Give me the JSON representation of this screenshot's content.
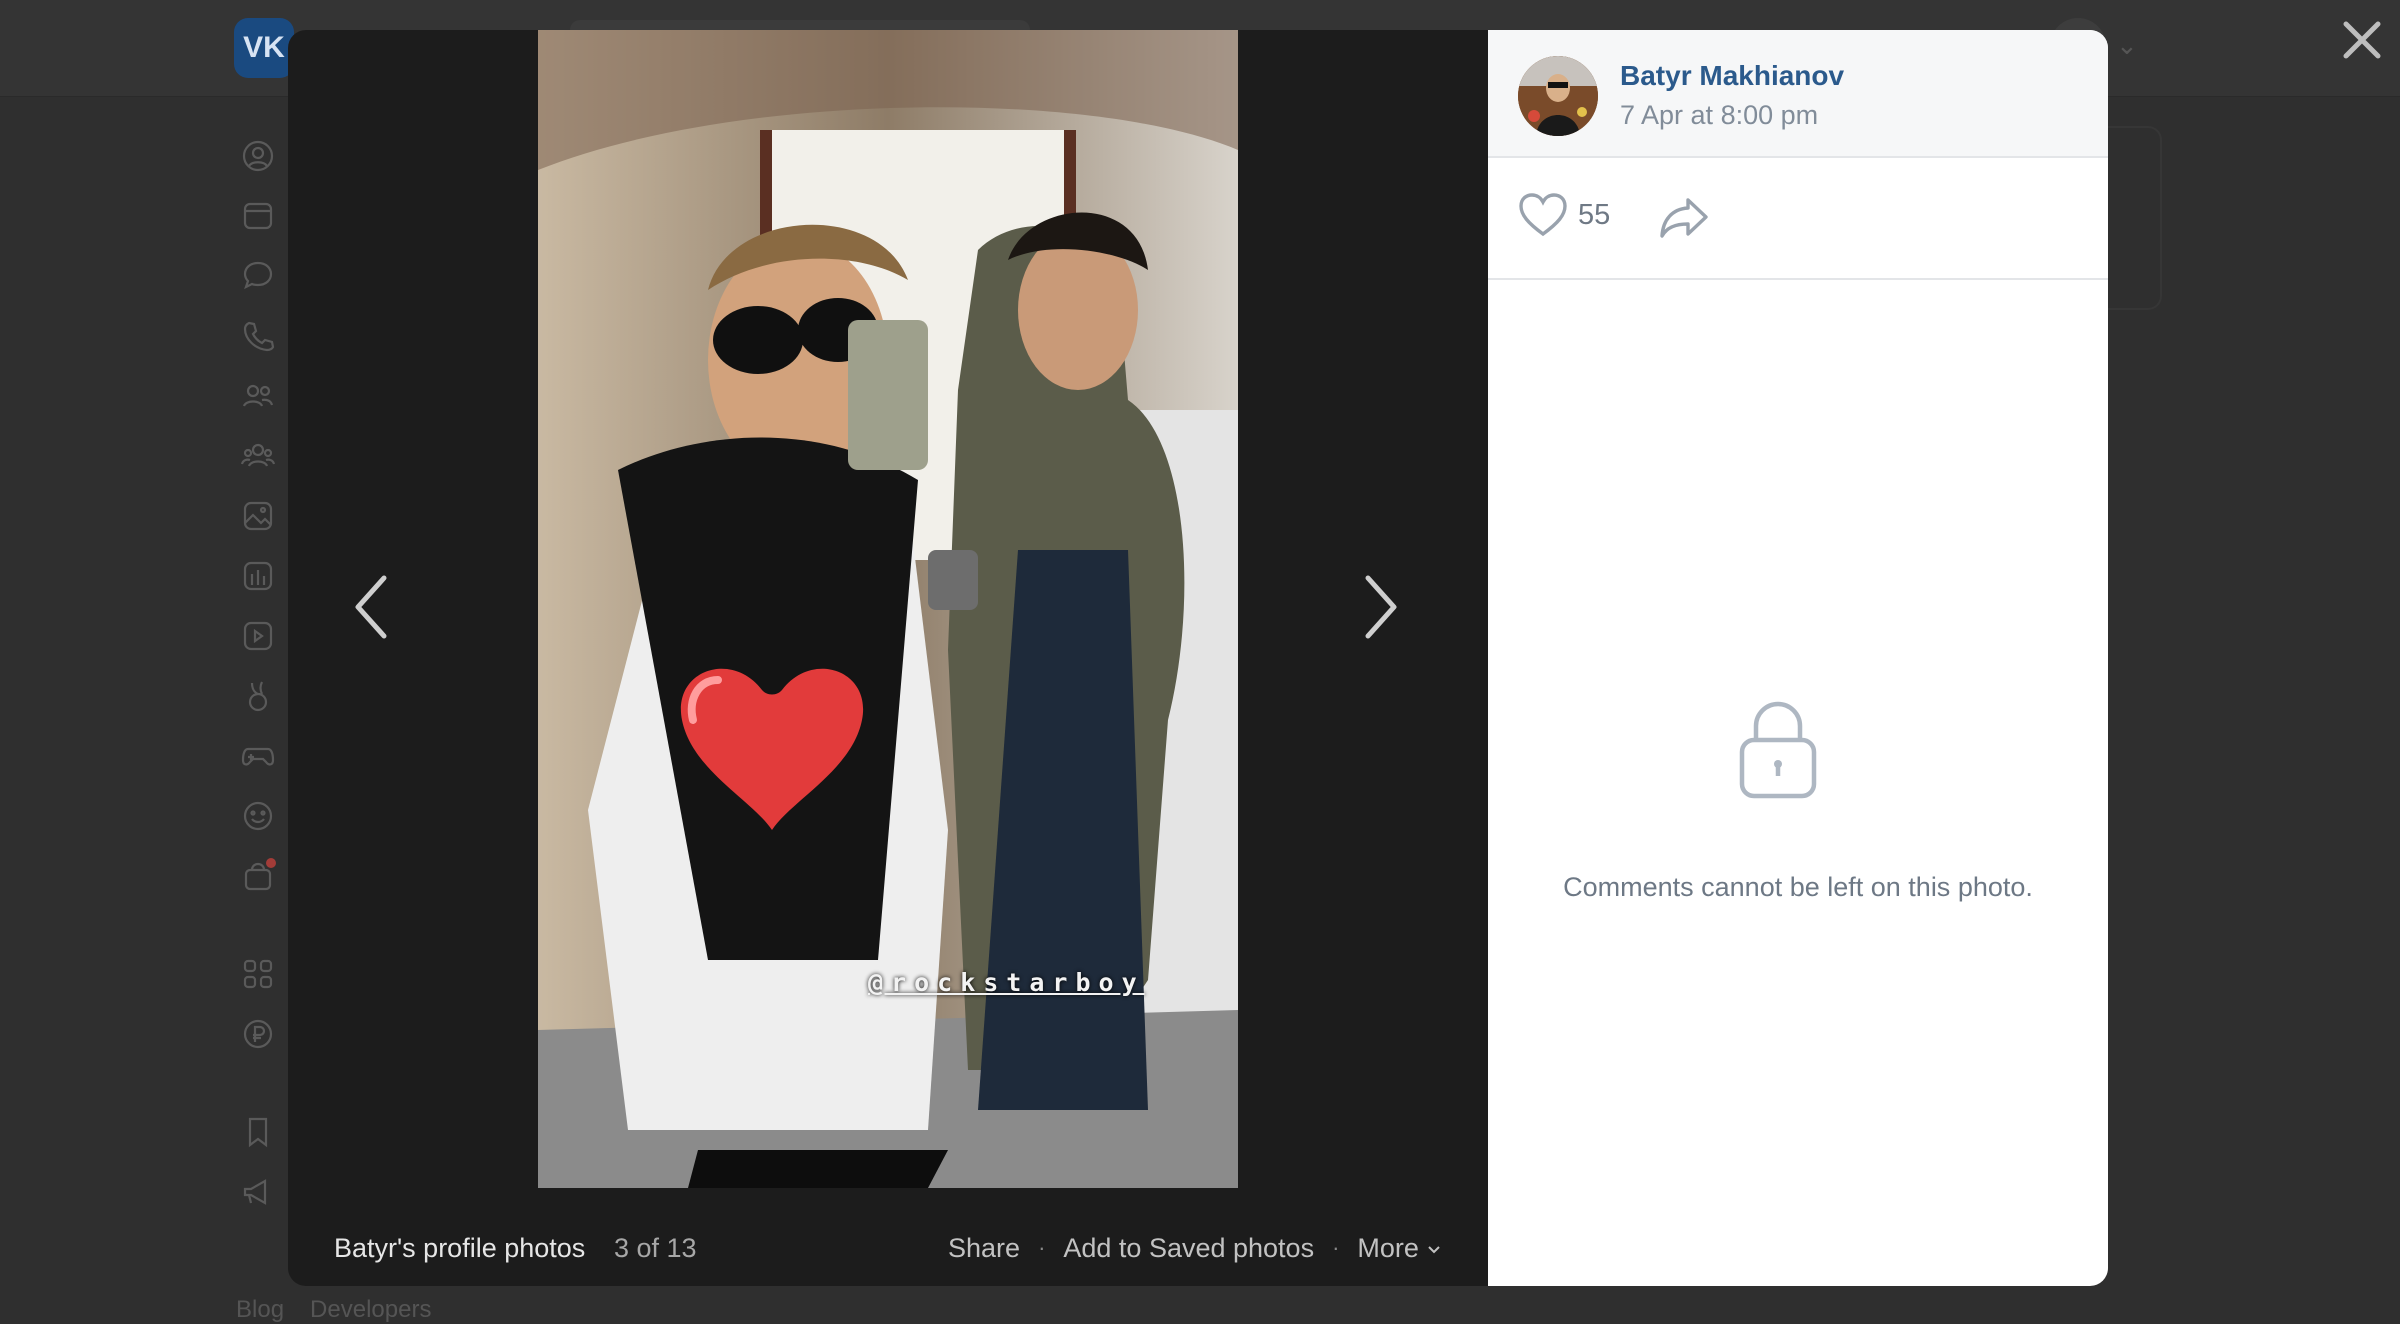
{
  "background": {
    "logo_text": "VK",
    "footer_links": [
      "Blog",
      "Developers"
    ]
  },
  "viewer": {
    "album_title": "Batyr's profile photos",
    "counter": "3 of 13",
    "actions": {
      "share": "Share",
      "save": "Add to Saved photos",
      "more": "More"
    },
    "photo": {
      "watermark": "@rockstarboy"
    }
  },
  "panel": {
    "author": "Batyr Makhianov",
    "date": "7 Apr at 8:00 pm",
    "likes": "55",
    "comments_disabled": "Comments cannot be left on this photo."
  },
  "colors": {
    "author_link": "#2b5a8c",
    "muted_text": "#818c99",
    "viewer_bg": "#1c1c1c"
  }
}
